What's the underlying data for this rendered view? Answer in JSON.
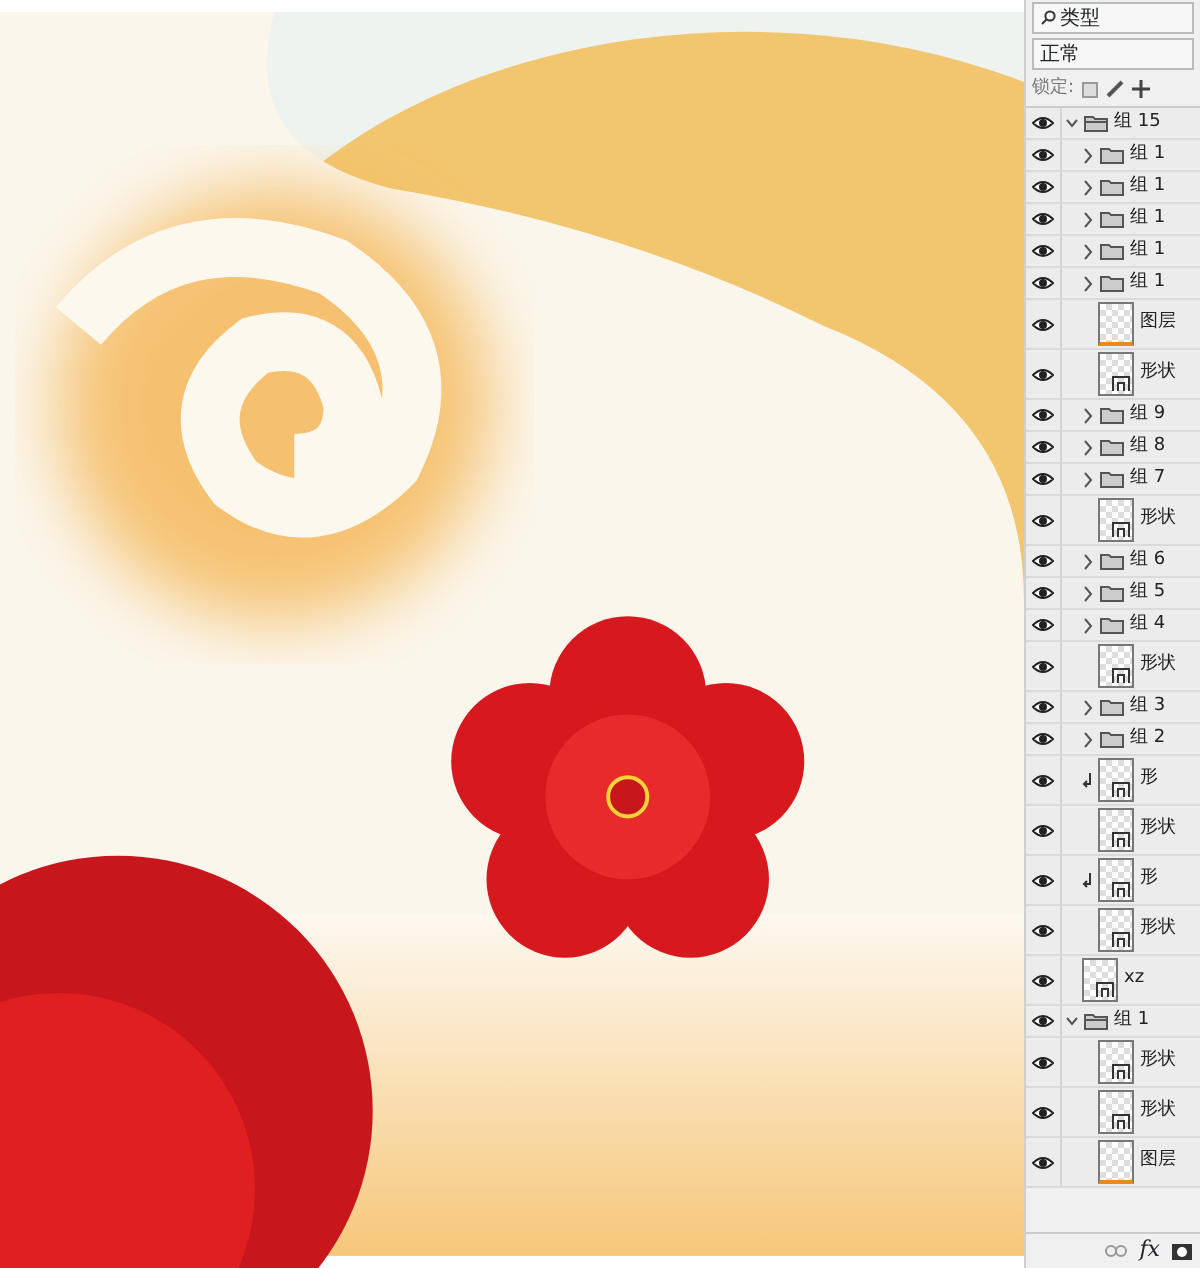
{
  "filter": {
    "label": "类型"
  },
  "blend_mode": "正常",
  "lock_label": "锁定:",
  "bottom_bar": {
    "fx": "fx"
  },
  "layers": [
    {
      "kind": "group",
      "name": "组 15",
      "visible": true,
      "expanded": true,
      "children": [
        {
          "kind": "group",
          "name": "组 1",
          "visible": true,
          "expanded": false
        },
        {
          "kind": "group",
          "name": "组 1",
          "visible": true,
          "expanded": false
        },
        {
          "kind": "group",
          "name": "组 1",
          "visible": true,
          "expanded": false
        },
        {
          "kind": "group",
          "name": "组 1",
          "visible": true,
          "expanded": false
        },
        {
          "kind": "group",
          "name": "组 1",
          "visible": true,
          "expanded": false
        },
        {
          "kind": "pixel",
          "name": "图层",
          "visible": true,
          "clipped": false
        },
        {
          "kind": "shape",
          "name": "形状",
          "visible": true,
          "clipped": false
        },
        {
          "kind": "group",
          "name": "组 9",
          "visible": true,
          "expanded": false
        },
        {
          "kind": "group",
          "name": "组 8",
          "visible": true,
          "expanded": false
        },
        {
          "kind": "group",
          "name": "组 7",
          "visible": true,
          "expanded": false
        },
        {
          "kind": "shape",
          "name": "形状",
          "visible": true,
          "clipped": false
        },
        {
          "kind": "group",
          "name": "组 6",
          "visible": true,
          "expanded": false
        },
        {
          "kind": "group",
          "name": "组 5",
          "visible": true,
          "expanded": false
        },
        {
          "kind": "group",
          "name": "组 4",
          "visible": true,
          "expanded": false
        },
        {
          "kind": "shape",
          "name": "形状",
          "visible": true,
          "clipped": false
        },
        {
          "kind": "group",
          "name": "组 3",
          "visible": true,
          "expanded": false
        },
        {
          "kind": "group",
          "name": "组 2",
          "visible": true,
          "expanded": false
        },
        {
          "kind": "shape",
          "name": "形",
          "visible": true,
          "clipped": true
        },
        {
          "kind": "shape",
          "name": "形状",
          "visible": true,
          "clipped": false
        },
        {
          "kind": "shape",
          "name": "形",
          "visible": true,
          "clipped": true
        },
        {
          "kind": "shape",
          "name": "形状",
          "visible": true,
          "clipped": false
        }
      ]
    },
    {
      "kind": "shape",
      "name": "xz",
      "visible": true,
      "clipped": false
    },
    {
      "kind": "group",
      "name": "组 1",
      "visible": true,
      "expanded": true,
      "children": [
        {
          "kind": "shape",
          "name": "形状",
          "visible": true,
          "clipped": false
        },
        {
          "kind": "shape",
          "name": "形状",
          "visible": true,
          "clipped": false
        },
        {
          "kind": "pixel",
          "name": "图层",
          "visible": true,
          "clipped": false
        }
      ]
    }
  ]
}
